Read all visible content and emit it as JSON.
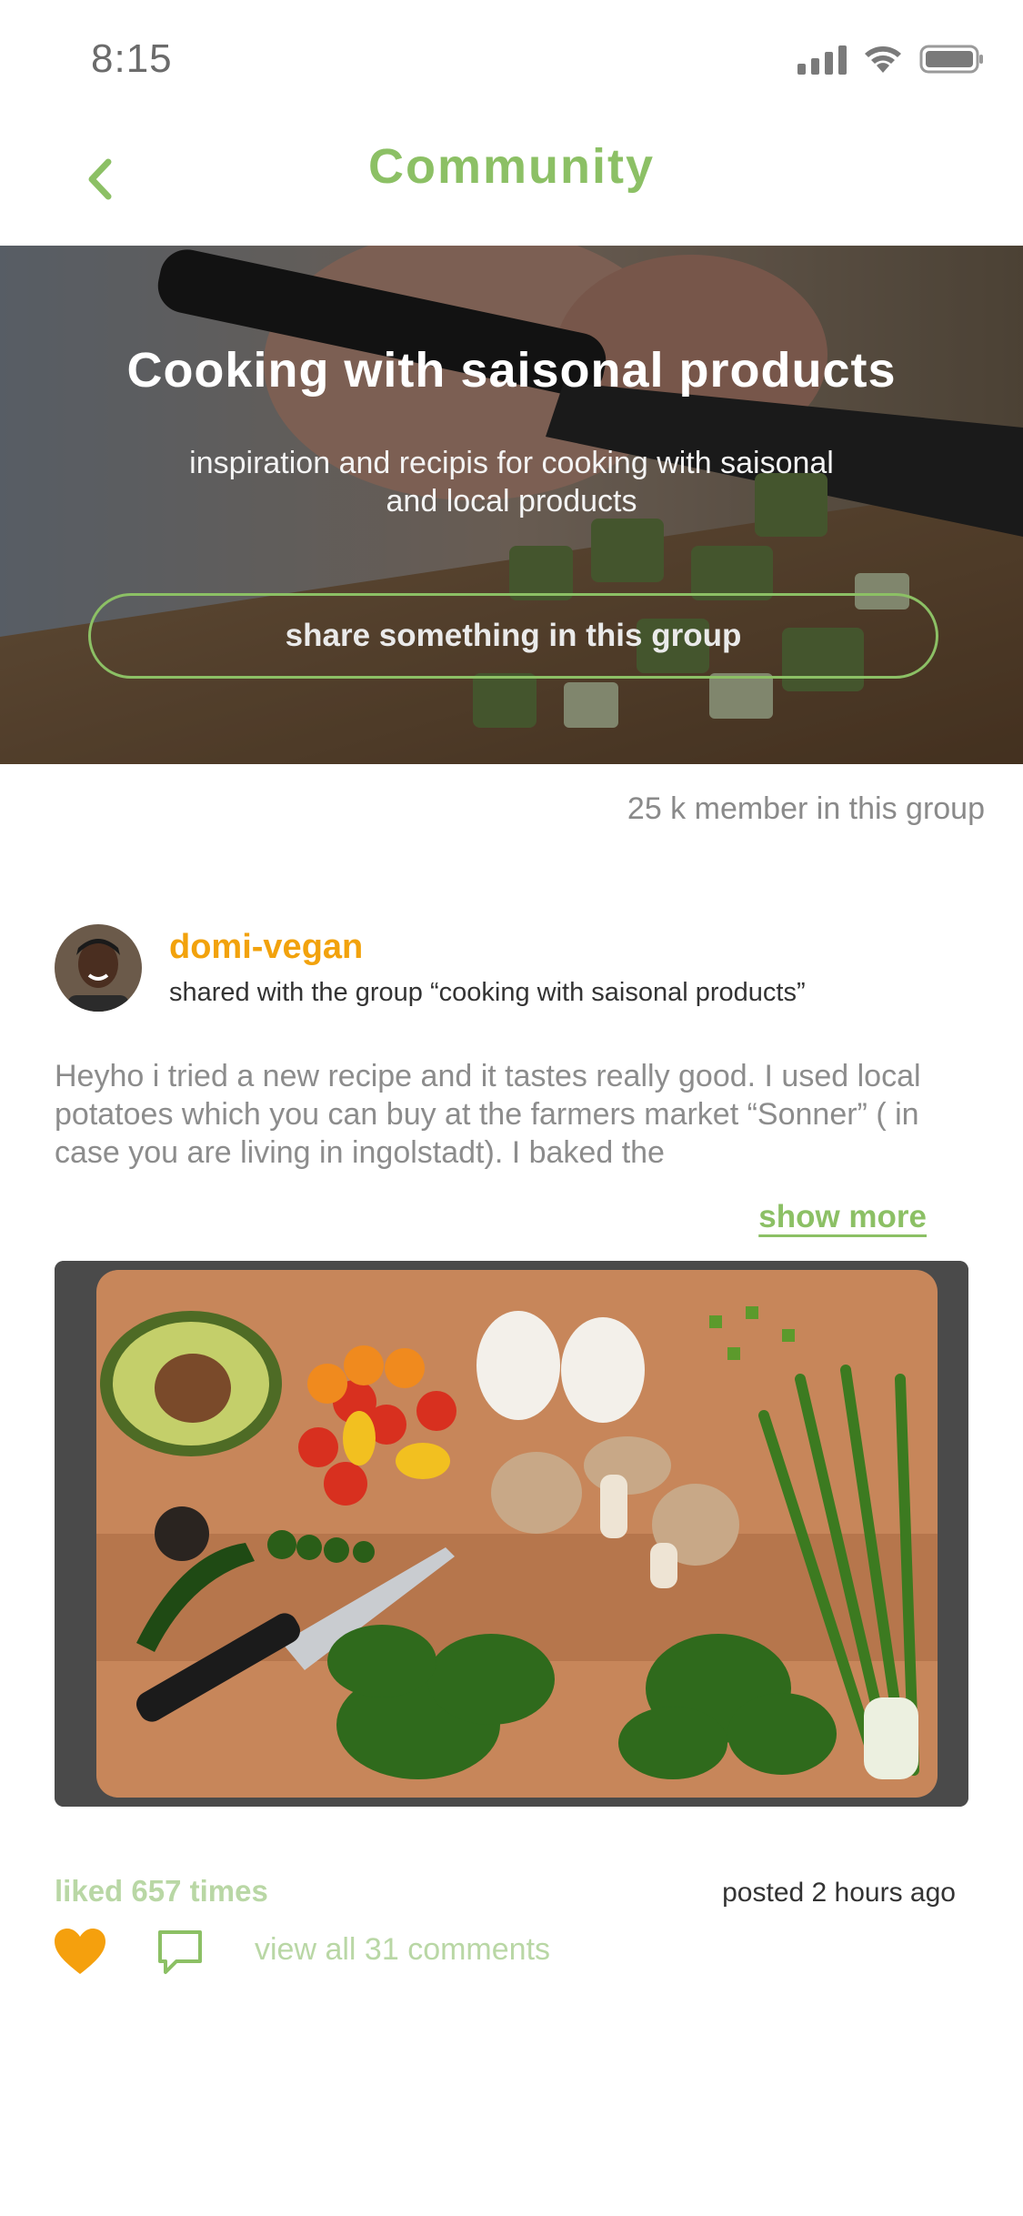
{
  "status_bar": {
    "time": "8:15",
    "icons": [
      "signal-icon",
      "wifi-icon",
      "battery-icon"
    ]
  },
  "nav": {
    "back_icon": "chevron-left-icon",
    "title": "Community"
  },
  "group": {
    "title": "Cooking with saisonal products",
    "description": "inspiration and recipis for cooking with saisonal and local products",
    "share_button": "share something in this group",
    "member_count": "25 k member in this group"
  },
  "post": {
    "author": "domi-vegan",
    "shared_with": "shared with the group “cooking with saisonal products”",
    "text": "Heyho i tried a new recipe and it tastes really good. I used local potatoes which you can buy at the farmers market “Sonner” ( in case you are living in ingolstadt). I baked the",
    "show_more": "show more",
    "liked": "liked 657 times",
    "posted": "posted 2 hours ago",
    "view_comments": "view all 31 comments"
  },
  "colors": {
    "accent_green": "#8cc065",
    "accent_orange": "#f2a20c",
    "light_green": "#b9d7a5",
    "muted_text": "#8c8c8c"
  }
}
